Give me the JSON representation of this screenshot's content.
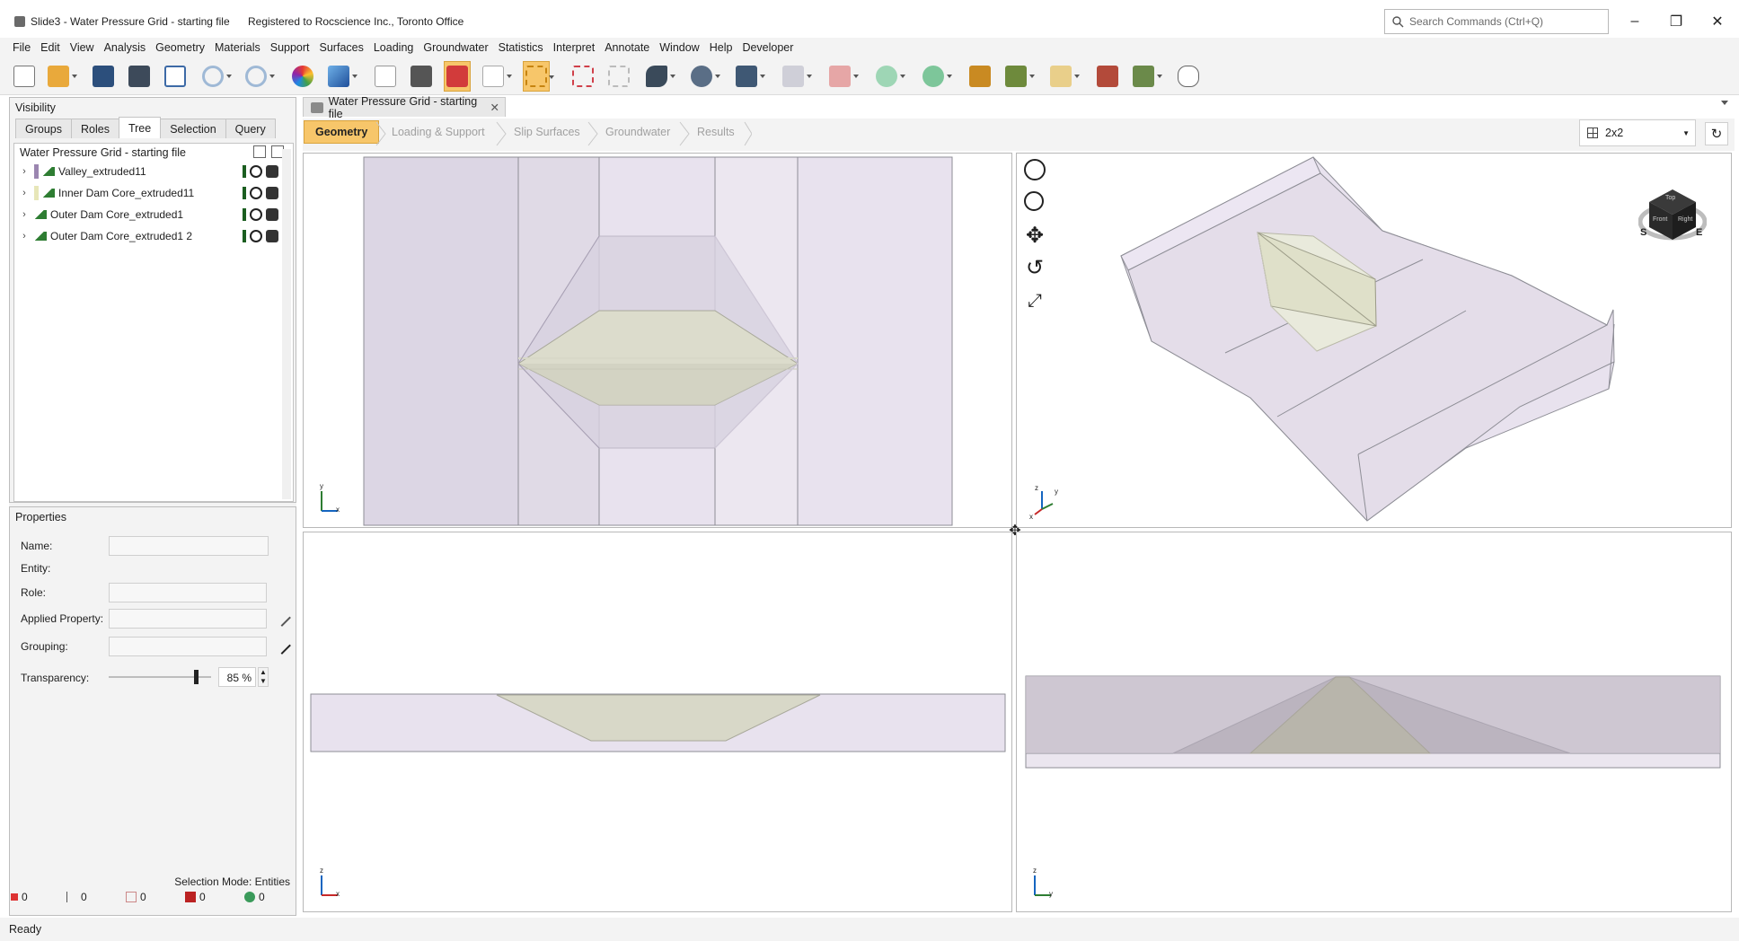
{
  "window": {
    "title": "Slide3 - Water Pressure Grid - starting file",
    "registration": "Registered to Rocscience Inc., Toronto Office",
    "search_placeholder": "Search Commands (Ctrl+Q)"
  },
  "menu": [
    "File",
    "Edit",
    "View",
    "Analysis",
    "Geometry",
    "Materials",
    "Support",
    "Surfaces",
    "Loading",
    "Groundwater",
    "Statistics",
    "Interpret",
    "Annotate",
    "Window",
    "Help",
    "Developer"
  ],
  "visibility": {
    "header": "Visibility",
    "tabs": [
      "Groups",
      "Roles",
      "Tree",
      "Selection",
      "Query"
    ],
    "selected_tab": "Tree",
    "tree_title": "Water Pressure Grid - starting file",
    "items": [
      {
        "label": "Valley_extruded11",
        "color": "#9b86b0"
      },
      {
        "label": "Inner Dam Core_extruded11",
        "color": "#e7e6b8"
      },
      {
        "label": "Outer Dam Core_extruded1",
        "color": "#2e7d32"
      },
      {
        "label": "Outer Dam Core_extruded1 2",
        "color": "#2e7d32"
      }
    ]
  },
  "properties": {
    "header": "Properties",
    "name_label": "Name:",
    "entity_label": "Entity:",
    "role_label": "Role:",
    "applied_label": "Applied Property:",
    "grouping_label": "Grouping:",
    "transparency_label": "Transparency:",
    "transparency_value": "85 %",
    "transparency_level": 0.85,
    "selection_mode": "Selection Mode: Entities",
    "counts": [
      "0",
      "0",
      "0",
      "0",
      "0"
    ]
  },
  "document": {
    "tab": "Water Pressure Grid - starting file",
    "workflow": [
      "Geometry",
      "Loading & Support",
      "Slip Surfaces",
      "Groundwater",
      "Results"
    ],
    "selected_step": "Geometry",
    "layout": "2x2"
  },
  "viewcube": {
    "top": "Top",
    "face": "Front",
    "right": "Right",
    "compass_s": "S",
    "compass_e": "E"
  },
  "axes": {
    "plan": [
      "y",
      "x"
    ],
    "iso": [
      "z",
      "x",
      "y"
    ],
    "front": [
      "z",
      "x"
    ],
    "side": [
      "z",
      "y"
    ]
  },
  "status": "Ready",
  "colors": {
    "accent": "#f7c66a",
    "valley": "#e8e2ee",
    "core": "#e7e6d0",
    "panel": "#f3f3f3"
  }
}
